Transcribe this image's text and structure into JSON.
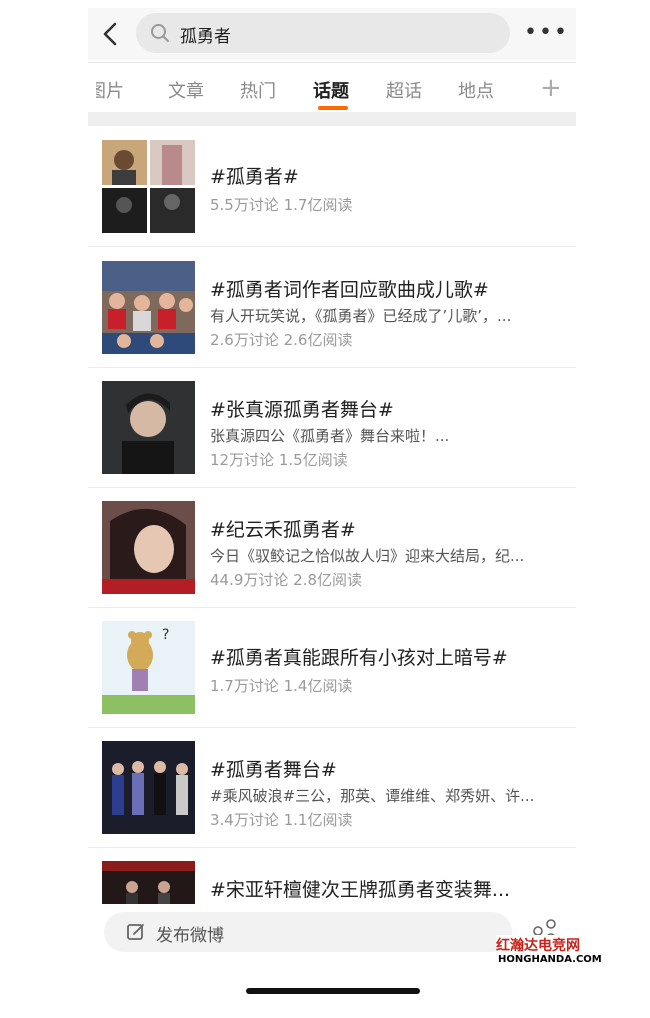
{
  "search": {
    "query": "孤勇者"
  },
  "tabs": [
    {
      "label": "图片"
    },
    {
      "label": "文章"
    },
    {
      "label": "热门"
    },
    {
      "label": "话题",
      "active": true
    },
    {
      "label": "超话"
    },
    {
      "label": "地点"
    }
  ],
  "results": [
    {
      "title": "#孤勇者#",
      "desc": "",
      "stats": "5.5万讨论 1.7亿阅读",
      "thumb": "grid-of-four-photos"
    },
    {
      "title": "#孤勇者词作者回应歌曲成儿歌#",
      "desc": "有人开玩笑说，《孤勇者》已经成了’儿歌’，...",
      "stats": "2.6万讨论 2.6亿阅读",
      "thumb": "classroom-children"
    },
    {
      "title": "#张真源孤勇者舞台#",
      "desc": "张真源四公《孤勇者》舞台来啦！...",
      "stats": "12万讨论 1.5亿阅读",
      "thumb": "stage-performer"
    },
    {
      "title": "#纪云禾孤勇者#",
      "desc": "今日《驭鲛记之恰似故人归》迎来大结局，纪...",
      "stats": "44.9万讨论 2.8亿阅读",
      "thumb": "drama-actress"
    },
    {
      "title": "#孤勇者真能跟所有小孩对上暗号#",
      "desc": "",
      "stats": "1.7万讨论 1.4亿阅读",
      "thumb": "cartoon-bear"
    },
    {
      "title": "#孤勇者舞台#",
      "desc": "#乘风破浪#三公，那英、谭维维、郑秀妍、许...",
      "stats": "3.4万讨论 1.1亿阅读",
      "thumb": "group-stage"
    },
    {
      "title": "#宋亚轩檀健次王牌孤勇者变装舞...",
      "desc": "",
      "stats": "",
      "thumb": "stage-dark"
    }
  ],
  "compose": {
    "label": "发布微博"
  },
  "watermark": {
    "cn": "红瀚达电竞网",
    "en": "HONGHANDA.COM"
  },
  "colors": {
    "accent": "#ff6a00",
    "stats": "#9a9a9a"
  }
}
